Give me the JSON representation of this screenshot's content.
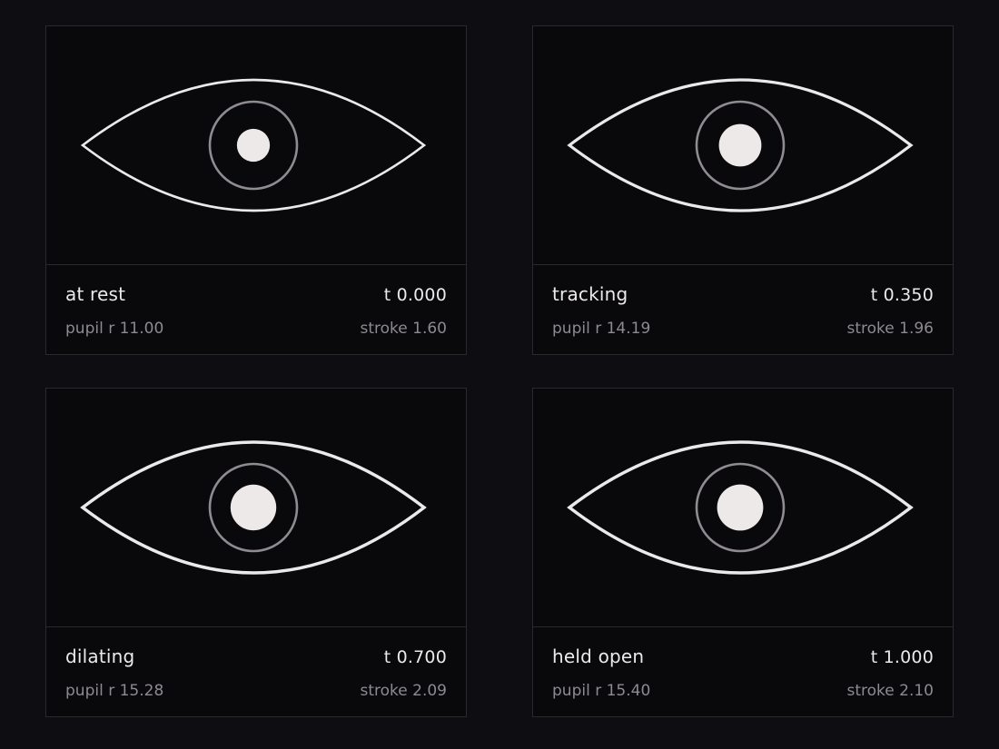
{
  "colors": {
    "background": "#0e0d12",
    "card": "#09080b",
    "border": "#2a2a2e",
    "text": "#ece9ec",
    "muted": "#8d8a90",
    "pupil": "#ece9e8",
    "iris": "#8f8b90"
  },
  "cards": [
    {
      "name": "at rest",
      "t": "t 0.000",
      "pupil_label": "pupil r 11.00",
      "stroke_label": "stroke 1.60",
      "pupil_r": 11.0,
      "stroke": 1.6
    },
    {
      "name": "tracking",
      "t": "t 0.350",
      "pupil_label": "pupil r 14.19",
      "stroke_label": "stroke 1.96",
      "pupil_r": 14.19,
      "stroke": 1.96
    },
    {
      "name": "dilating",
      "t": "t 0.700",
      "pupil_label": "pupil r 15.28",
      "stroke_label": "stroke 2.09",
      "pupil_r": 15.28,
      "stroke": 2.09
    },
    {
      "name": "held open",
      "t": "t 1.000",
      "pupil_label": "pupil r 15.40",
      "stroke_label": "stroke 2.10",
      "pupil_r": 15.4,
      "stroke": 2.1
    }
  ]
}
